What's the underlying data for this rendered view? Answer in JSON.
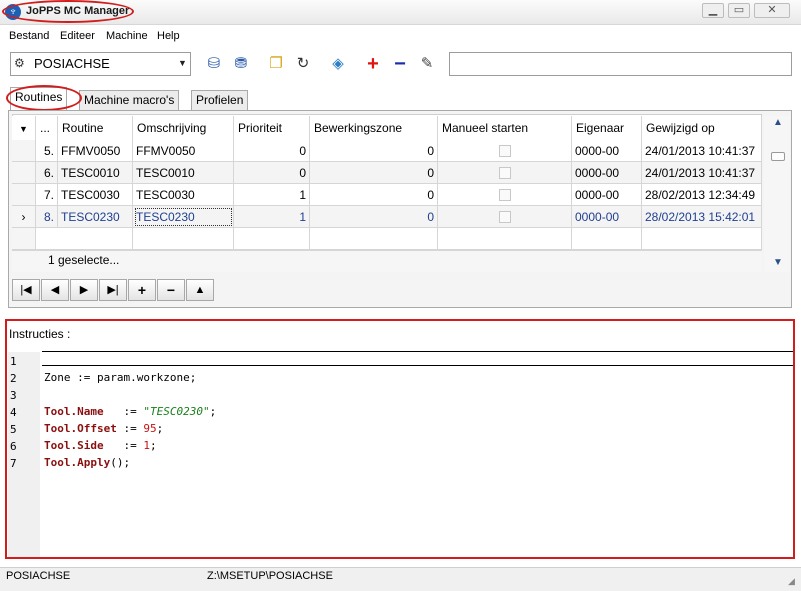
{
  "window": {
    "title": "JoPPS MC Manager",
    "icon_glyph": "♆"
  },
  "menu": [
    "Bestand",
    "Editeer",
    "Machine",
    "Help"
  ],
  "toolbar": {
    "profile_select": "POSIACHSE",
    "icons": [
      "import-db-icon",
      "export-db-icon",
      "copy-icon",
      "refresh-icon",
      "cube-icon",
      "add-icon",
      "remove-icon",
      "pen-icon"
    ],
    "search_value": ""
  },
  "tabs": [
    {
      "label": "Routines",
      "active": true
    },
    {
      "label": "Machine macro's",
      "active": false
    },
    {
      "label": "Profielen",
      "active": false
    }
  ],
  "grid": {
    "columns": [
      "...",
      "Routine",
      "Omschrijving",
      "Prioriteit",
      "Bewerkingszone",
      "Manueel starten",
      "Eigenaar",
      "Gewijzigd op"
    ],
    "rows": [
      {
        "nr": "5.",
        "routine": "FFMV0050",
        "omschrijving": "FFMV0050",
        "prioriteit": "0",
        "bewerkingszone": "0",
        "manueel": false,
        "eigenaar": "0000-00",
        "gewijzigd": "24/01/2013 10:41:37"
      },
      {
        "nr": "6.",
        "routine": "TESC0010",
        "omschrijving": "TESC0010",
        "prioriteit": "0",
        "bewerkingszone": "0",
        "manueel": false,
        "eigenaar": "0000-00",
        "gewijzigd": "24/01/2013 10:41:37"
      },
      {
        "nr": "7.",
        "routine": "TESC0030",
        "omschrijving": "TESC0030",
        "prioriteit": "1",
        "bewerkingszone": "0",
        "manueel": false,
        "eigenaar": "0000-00",
        "gewijzigd": "28/02/2013 12:34:49"
      },
      {
        "nr": "8.",
        "routine": "TESC0230",
        "omschrijving": "TESC0230",
        "prioriteit": "1",
        "bewerkingszone": "0",
        "manueel": false,
        "eigenaar": "0000-00",
        "gewijzigd": "28/02/2013 15:42:01"
      }
    ],
    "footer": "1 geselecte..."
  },
  "instructions": {
    "label": "Instructies :",
    "line_numbers": [
      "1",
      "2",
      "3",
      "4",
      "5",
      "6",
      "7"
    ],
    "code": {
      "l2": "Zone := param.workzone;",
      "l4_kw": "Tool.Name",
      "l4_op": "   := ",
      "l4_val": "\"TESC0230\"",
      "l4_end": ";",
      "l5_kw": "Tool.Offset",
      "l5_op": " := ",
      "l5_val": "95",
      "l5_end": ";",
      "l6_kw": "Tool.Side",
      "l6_op": "   := ",
      "l6_val": "1",
      "l6_end": ";",
      "l7_kw": "Tool.Apply",
      "l7_end": "();"
    }
  },
  "status": {
    "left": "POSIACHSE",
    "path": "Z:\\MSETUP\\POSIACHSE"
  },
  "colors": {
    "highlight": "#d21d1d",
    "keyword": "#8a0f0f",
    "string": "#1b7f1b",
    "number": "#c31212",
    "selected_text": "#1f3f8f"
  }
}
